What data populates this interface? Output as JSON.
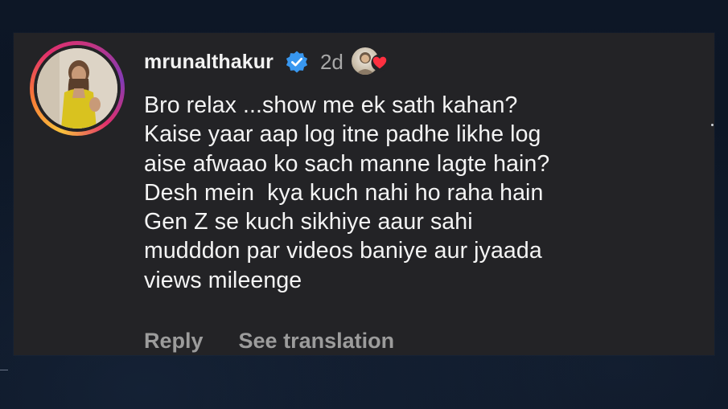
{
  "comment": {
    "username": "mrunalthakur",
    "time_ago": "2d",
    "verified_icon": "verified-badge-icon",
    "liked_icon": "heart-icon",
    "colors": {
      "verified": "#3897f0",
      "heart": "#ff3040",
      "text": "#f4f4f4",
      "muted": "#9c9c9c",
      "card": "#232326"
    },
    "lines": [
      "Bro relax ...show me ek sath kahan?",
      "Kaise yaar aap log itne padhe likhe log",
      "aise afwaao ko sach manne lagte hain?",
      "Desh mein  kya kuch nahi ho raha hain",
      "Gen Z se kuch sikhiye aaur sahi",
      "mudddon par videos baniye aur jyaada",
      "views mileenge"
    ],
    "actions": {
      "reply": "Reply",
      "translate": "See translation"
    }
  }
}
